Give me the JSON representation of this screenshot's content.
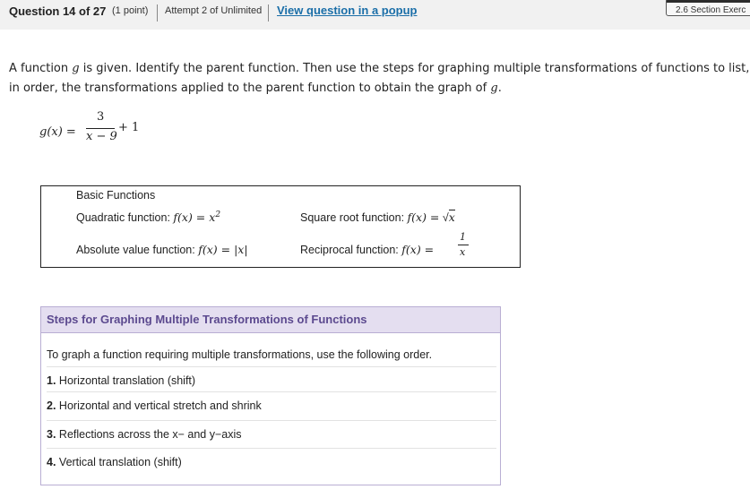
{
  "header": {
    "question": "Question 14 of 27",
    "points": "(1 point)",
    "attempt": "Attempt 2 of Unlimited",
    "popup_link": "View question in a popup",
    "section": "2.6 Section Exerc"
  },
  "prompt": {
    "part1": "A function",
    "g1": "g",
    "part2": "is given. Identify the parent function. Then use the steps for graphing multiple transformations of functions to list, in order, the transformations applied to the parent function to obtain the graph of",
    "g2": "g",
    "end": "."
  },
  "formula": {
    "lhs": "g(x) =",
    "numerator": "3",
    "denominator": "x − 9",
    "tail": "+ 1"
  },
  "basic_functions": {
    "title": "Basic Functions",
    "quadratic_label": "Quadratic function:",
    "quadratic_expr": "f(x) = x",
    "quadratic_exp": "2",
    "sqrt_label": "Square root function:",
    "sqrt_expr": "f(x) =",
    "sqrt_rad": "x",
    "abs_label": "Absolute value function:",
    "abs_expr": "f(x) = |x|",
    "recip_label": "Reciprocal function:",
    "recip_expr": "f(x) =",
    "recip_num": "1",
    "recip_den": "x"
  },
  "steps": {
    "title": "Steps for Graphing Multiple Transformations of Functions",
    "intro": "To graph a function requiring multiple transformations, use the following order.",
    "items": [
      {
        "num": "1.",
        "text": "Horizontal translation (shift)"
      },
      {
        "num": "2.",
        "text": "Horizontal and vertical stretch and shrink"
      },
      {
        "num": "3.",
        "text": "Reflections across the x− and y−axis"
      },
      {
        "num": "4.",
        "text": "Vertical translation (shift)"
      }
    ]
  }
}
